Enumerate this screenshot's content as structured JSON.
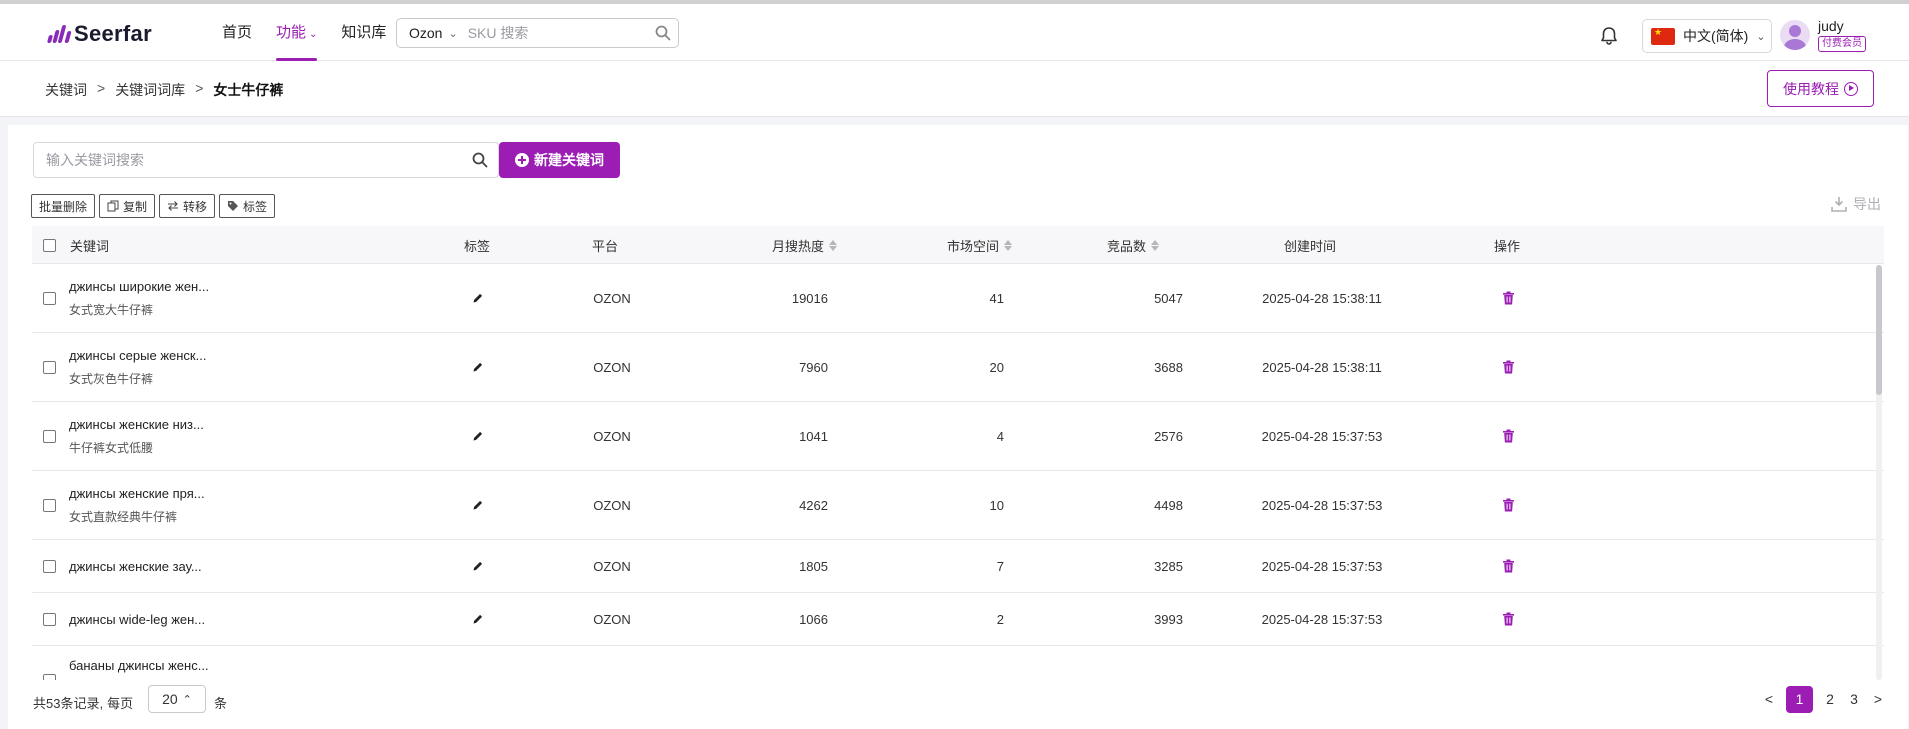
{
  "brand": {
    "name": "Seerfar",
    "accent": "#9b1db4"
  },
  "nav": {
    "items": [
      {
        "label": "首页",
        "active": false
      },
      {
        "label": "功能",
        "active": true,
        "has_dropdown": true
      },
      {
        "label": "知识库",
        "active": false
      }
    ]
  },
  "sku_search": {
    "platform": "Ozon",
    "placeholder": "SKU 搜索"
  },
  "language": {
    "label": "中文(简体)"
  },
  "user": {
    "name": "judy",
    "badge": "付费会员"
  },
  "breadcrumb": {
    "items": [
      "关键词",
      "关键词词库"
    ],
    "current": "女士牛仔裤",
    "separator": ">"
  },
  "tutorial_button": "使用教程",
  "keyword_search": {
    "placeholder": "输入关键词搜索"
  },
  "new_keyword_button": "新建关键词",
  "toolbar": {
    "batch_delete": "批量删除",
    "copy": "复制",
    "transfer": "转移",
    "tag": "标签",
    "export": "导出"
  },
  "table": {
    "headers": {
      "keyword": "关键词",
      "tag": "标签",
      "platform": "平台",
      "monthly_search": "月搜热度",
      "market_space": "市场空间",
      "competitors": "竞品数",
      "created": "创建时间",
      "actions": "操作"
    },
    "rows": [
      {
        "ru": "джинсы широкие жен...",
        "cn": "女式宽大牛仔裤",
        "platform": "OZON",
        "monthly": "19016",
        "market": "41",
        "competitors": "5047",
        "created": "2025-04-28 15:38:11"
      },
      {
        "ru": "джинсы серые женск...",
        "cn": "女式灰色牛仔裤",
        "platform": "OZON",
        "monthly": "7960",
        "market": "20",
        "competitors": "3688",
        "created": "2025-04-28 15:38:11"
      },
      {
        "ru": "джинсы женские низ...",
        "cn": "牛仔裤女式低腰",
        "platform": "OZON",
        "monthly": "1041",
        "market": "4",
        "competitors": "2576",
        "created": "2025-04-28 15:37:53"
      },
      {
        "ru": "джинсы женские пря...",
        "cn": "女式直款经典牛仔裤",
        "platform": "OZON",
        "monthly": "4262",
        "market": "10",
        "competitors": "4498",
        "created": "2025-04-28 15:37:53"
      },
      {
        "ru": "джинсы женские зау...",
        "cn": "",
        "platform": "OZON",
        "monthly": "1805",
        "market": "7",
        "competitors": "3285",
        "created": "2025-04-28 15:37:53"
      },
      {
        "ru": "джинсы wide-leg жен...",
        "cn": "",
        "platform": "OZON",
        "monthly": "1066",
        "market": "2",
        "competitors": "3993",
        "created": "2025-04-28 15:37:53"
      },
      {
        "ru": "бананы джинсы женс...",
        "cn": "",
        "platform": "",
        "monthly": "",
        "market": "",
        "competitors": "",
        "created": ""
      }
    ]
  },
  "pagination": {
    "total_text": "共53条记录,",
    "per_page_label": "每页",
    "page_size": "20",
    "unit": "条",
    "prev": "<",
    "next": ">",
    "pages": [
      "1",
      "2",
      "3"
    ],
    "current": "1"
  }
}
